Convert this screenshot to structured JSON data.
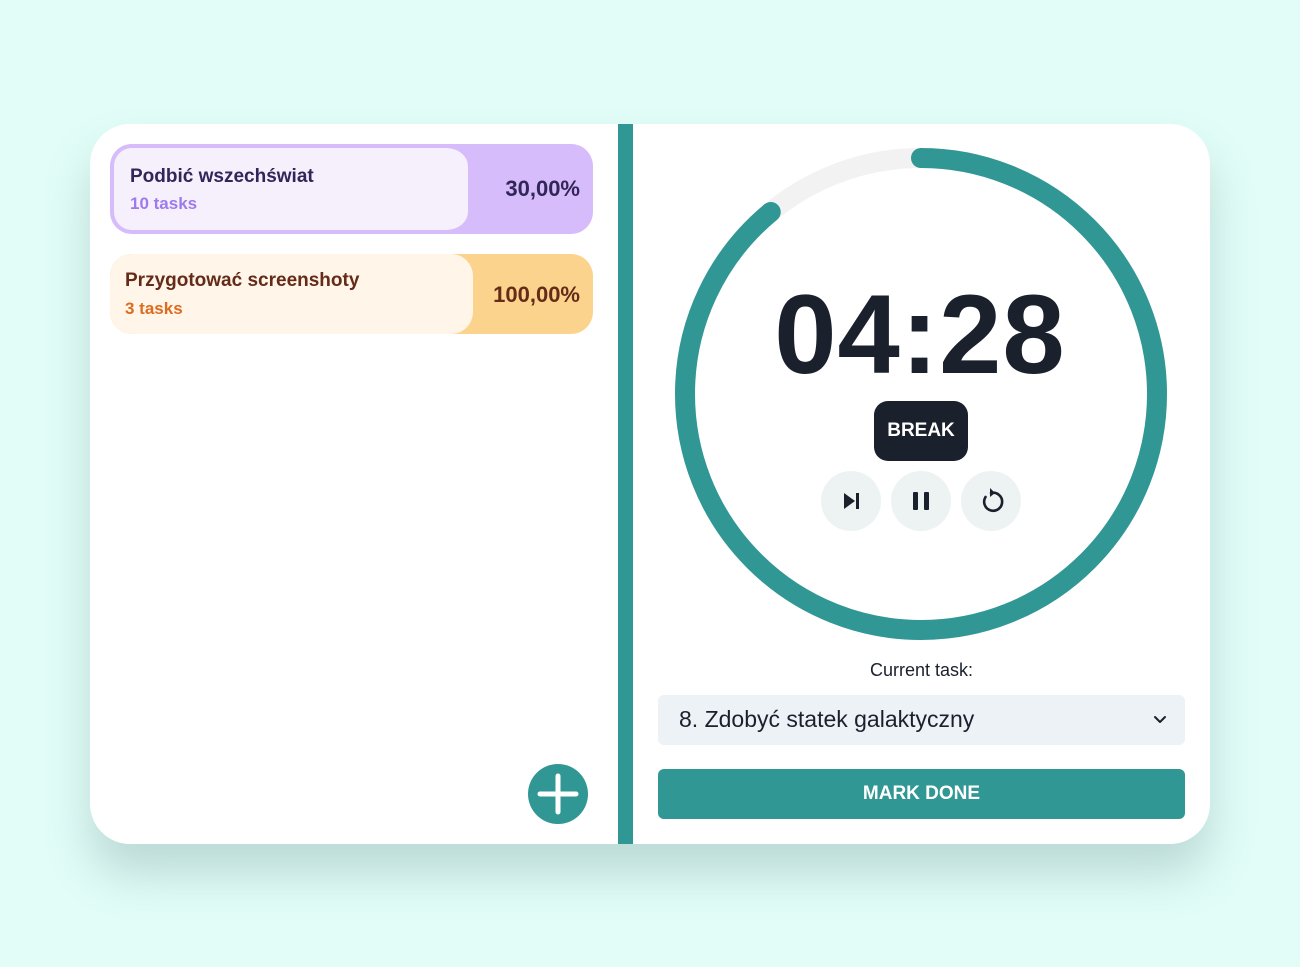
{
  "projects": [
    {
      "name": "Podbić wszechświat",
      "count": "10 tasks",
      "percent": "30,00%"
    },
    {
      "name": "Przygotować screenshoty",
      "count": "3 tasks",
      "percent": "100,00%"
    }
  ],
  "timer": {
    "time": "04:28",
    "mode": "BREAK",
    "progress": 0.89,
    "ring_color": "#319795",
    "track_color": "#f2f2f2"
  },
  "controls": {
    "skip_icon": "skip-next-icon",
    "pause_icon": "pause-icon",
    "reset_icon": "reset-icon",
    "add_icon": "plus-icon"
  },
  "current_task": {
    "label": "Current task:",
    "value": "8. Zdobyć statek galaktyczny"
  },
  "actions": {
    "mark_done": "MARK DONE"
  },
  "colors": {
    "accent": "#319795",
    "dark": "#1a202c",
    "purple_bg": "#d6bcfa",
    "orange_bg": "#fbd38d"
  }
}
